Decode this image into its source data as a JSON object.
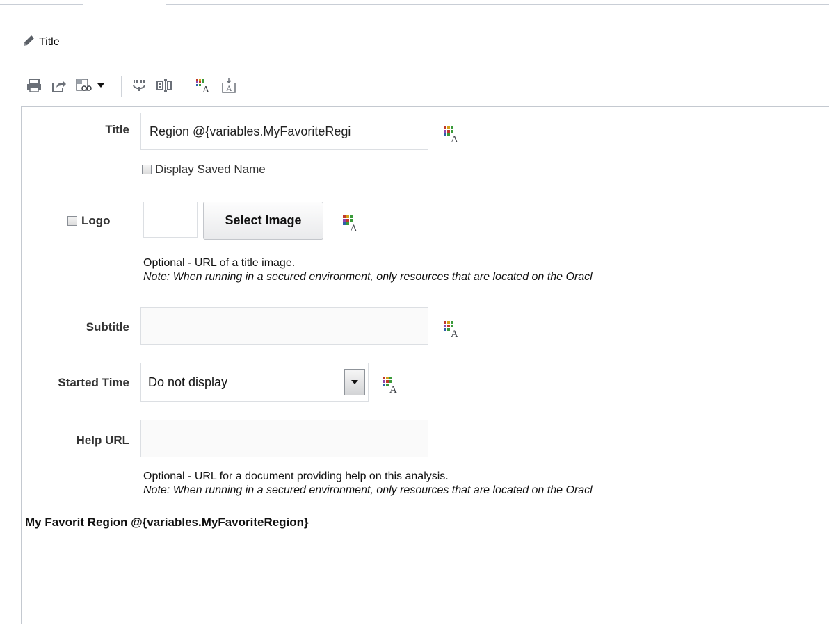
{
  "header": {
    "section_title": "Title"
  },
  "toolbar": {
    "items": [
      {
        "icon": "print-icon"
      },
      {
        "icon": "export-icon"
      },
      {
        "icon": "view-options-icon"
      },
      {
        "icon": "prompts-icon"
      },
      {
        "icon": "column-properties-icon"
      },
      {
        "icon": "format-text-icon"
      },
      {
        "icon": "insert-text-icon"
      }
    ]
  },
  "form": {
    "title": {
      "label": "Title",
      "value": "Region @{variables.MyFavoriteRegi",
      "display_saved_name": "Display Saved Name"
    },
    "logo": {
      "label": "Logo",
      "select_image": "Select Image",
      "hint": "Optional - URL of a title image.",
      "note": "Note: When running in a secured environment, only resources that are located on the Oracl"
    },
    "subtitle": {
      "label": "Subtitle",
      "value": ""
    },
    "started_time": {
      "label": "Started Time",
      "value": "Do not display"
    },
    "help_url": {
      "label": "Help URL",
      "value": "",
      "hint": "Optional - URL for a document providing help on this analysis.",
      "note": "Note: When running in a secured environment, only resources that are located on the Oracl"
    }
  },
  "preview": {
    "title": "My Favorit Region @{variables.MyFavoriteRegion}"
  },
  "colors": {
    "accent_red": "#c0392b",
    "accent_green": "#3a9a3a",
    "accent_blue": "#2e5fa8",
    "icon_gray": "#6b7078"
  }
}
